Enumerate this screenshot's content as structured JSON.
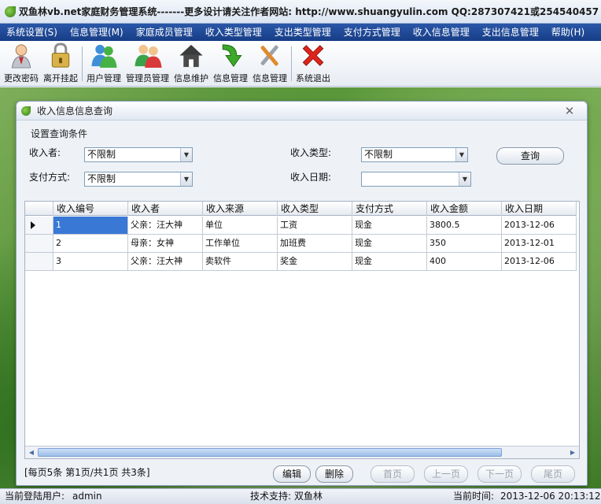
{
  "app": {
    "title": "双鱼林vb.net家庭财务管理系统-------更多设计请关注作者网站:   http://www.shuangyulin.com  QQ:287307421或254540457"
  },
  "menu": {
    "items": [
      {
        "label": "系统设置(S)"
      },
      {
        "label": "信息管理(M)"
      },
      {
        "label": "家庭成员管理"
      },
      {
        "label": "收入类型管理"
      },
      {
        "label": "支出类型管理"
      },
      {
        "label": "支付方式管理"
      },
      {
        "label": "收入信息管理"
      },
      {
        "label": "支出信息管理"
      },
      {
        "label": "帮助(H)"
      }
    ]
  },
  "toolbar": {
    "items": [
      {
        "label": "更改密码",
        "icon": "person-password-icon"
      },
      {
        "label": "离开挂起",
        "icon": "padlock-icon"
      },
      {
        "label": "用户管理",
        "icon": "users-icon"
      },
      {
        "label": "管理员管理",
        "icon": "admins-icon"
      },
      {
        "label": "信息维护",
        "icon": "house-icon"
      },
      {
        "label": "信息管理",
        "icon": "green-arrow-icon"
      },
      {
        "label": "信息管理",
        "icon": "tools-icon"
      },
      {
        "label": "系统退出",
        "icon": "red-x-icon"
      }
    ]
  },
  "dialog": {
    "title": "收入信息信息查询",
    "group_title": "设置查询条件",
    "fields": {
      "payer_label": "收入者:",
      "payer_value": "不限制",
      "type_label": "收入类型:",
      "type_value": "不限制",
      "method_label": "支付方式:",
      "method_value": "不限制",
      "date_label": "收入日期:",
      "date_value": ""
    },
    "query_button": "查询"
  },
  "grid": {
    "columns": [
      "收入编号",
      "收入者",
      "收入来源",
      "收入类型",
      "支付方式",
      "收入金额",
      "收入日期"
    ],
    "rows": [
      [
        "1",
        "父亲：汪大神",
        "单位",
        "工资",
        "现金",
        "3800.5",
        "2013-12-06"
      ],
      [
        "2",
        "母亲：女神",
        "工作单位",
        "加班费",
        "现金",
        "350",
        "2013-12-01"
      ],
      [
        "3",
        "父亲：汪大神",
        "卖软件",
        "奖金",
        "现金",
        "400",
        "2013-12-06"
      ]
    ]
  },
  "pager": {
    "info": "[每页5条  第1页/共1页    共3条]",
    "edit_button": "编辑",
    "delete_button": "删除",
    "first_button": "首页",
    "prev_button": "上一页",
    "next_button": "下一页",
    "last_button": "尾页"
  },
  "status": {
    "user_label": "当前登陆用户:",
    "user_value": "admin",
    "support_label": "技术支持:",
    "support_value": "双鱼林",
    "time_label": "当前时间:",
    "time_value": "2013-12-06 20:13:12"
  },
  "colors": {
    "menubar": "#1f4a97",
    "selection": "#3a78d6",
    "exit_red": "#e0241b",
    "arrow_green": "#3da82a"
  }
}
